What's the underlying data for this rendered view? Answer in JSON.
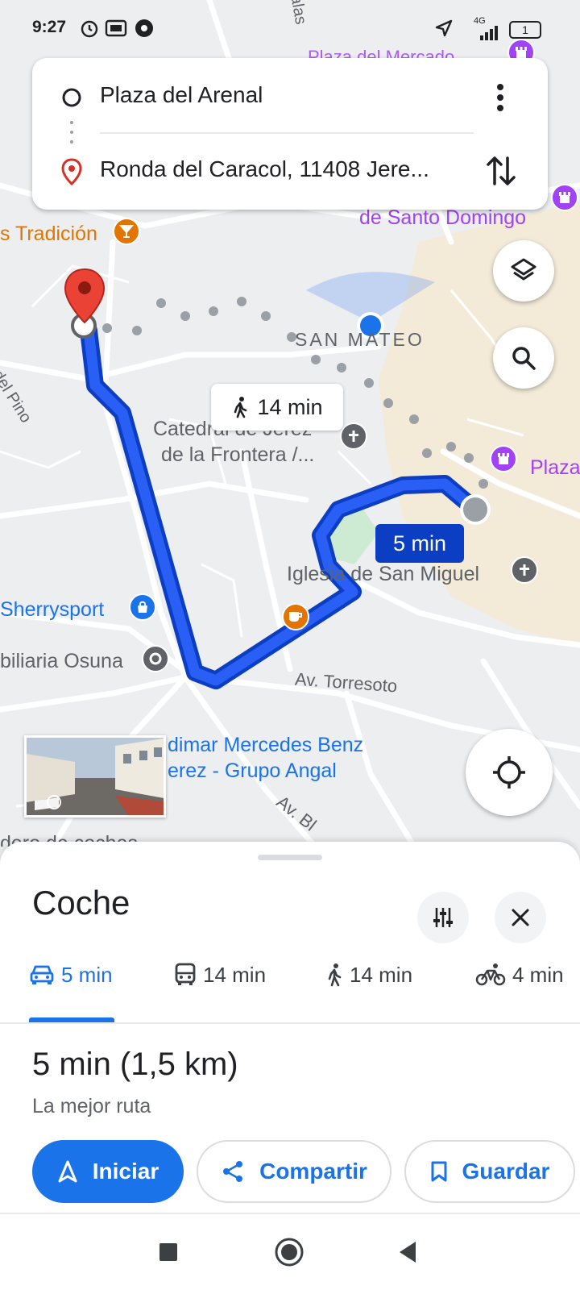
{
  "status_bar": {
    "time": "9:27",
    "network": "4G",
    "battery": "1"
  },
  "route": {
    "origin": "Plaza del Arenal",
    "destination": "Ronda del Caracol, 11408 Jere...",
    "menu_icon": "more-vert-icon",
    "swap_icon": "swap-vertical-icon"
  },
  "map": {
    "labels": {
      "tradicion": "s Tradición",
      "san_mateo": "SAN MATEO",
      "santo_domingo": "de Santo Domingo",
      "catedral_1": "Catedral de Jerez",
      "catedral_2": "de la Frontera /...",
      "plaza": "Plaza",
      "iglesia": "Iglesia de San Miguel",
      "sherrysport": "Sherrysport",
      "osuna": "biliaria Osuna",
      "torresoto": "Av. Torresoto",
      "mercedes_1": "dimar Mercedes Benz",
      "mercedes_2": "erez - Grupo Angal",
      "av_bottom": "Av. Bl",
      "coches": "dero de coches",
      "del_pino": "del Pino",
      "top_street": "alas",
      "top_plaza": "Plaza del Mercado"
    },
    "walk_eta": "14 min",
    "drive_eta": "5 min"
  },
  "sheet": {
    "title": "Coche",
    "modes": [
      {
        "name": "car",
        "label": "5 min"
      },
      {
        "name": "transit",
        "label": "14 min"
      },
      {
        "name": "walk",
        "label": "14 min"
      },
      {
        "name": "bike",
        "label": "4 min"
      }
    ],
    "summary": "5 min (1,5 km)",
    "subtitle": "La mejor ruta",
    "buttons": {
      "start": "Iniciar",
      "share": "Compartir",
      "save": "Guardar"
    }
  },
  "colors": {
    "route_blue": "#1a4be8",
    "accent": "#1a73e8",
    "destination_red": "#d93025",
    "poi_purple": "#a142f4",
    "poi_orange": "#e37400",
    "poi_gray": "#5f6368"
  }
}
